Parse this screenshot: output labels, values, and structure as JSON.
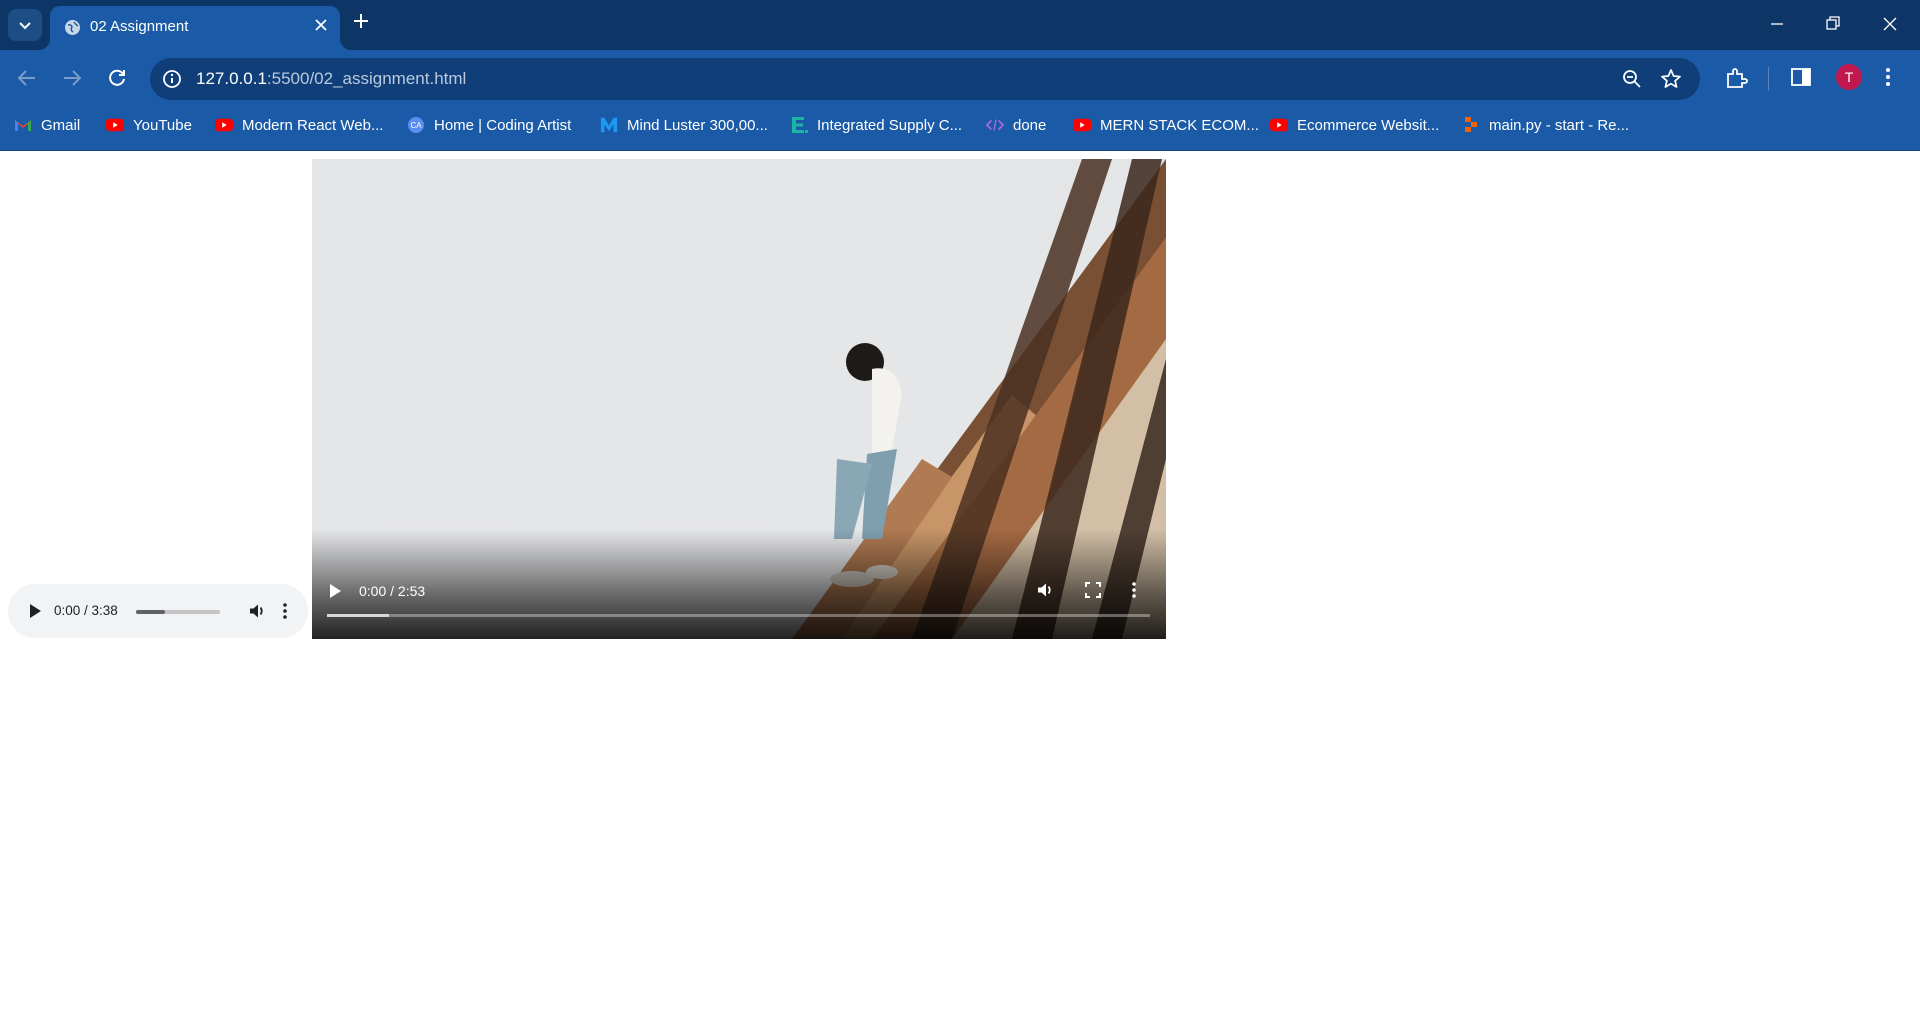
{
  "browser": {
    "tab": {
      "title": "02 Assignment"
    },
    "omnibox": {
      "url_host": "127.0.0.1",
      "url_path": ":5500/02_assignment.html"
    },
    "profile_initial": "T"
  },
  "bookmarks": [
    {
      "label": "Gmail",
      "icon": "gmail-icon"
    },
    {
      "label": "YouTube",
      "icon": "youtube-icon"
    },
    {
      "label": "Modern React Web...",
      "icon": "youtube-icon"
    },
    {
      "label": "Home | Coding Artist",
      "icon": "coding-artist-icon"
    },
    {
      "label": "Mind Luster 300,00...",
      "icon": "mind-luster-icon"
    },
    {
      "label": "Integrated Supply C...",
      "icon": "e-icon"
    },
    {
      "label": "done",
      "icon": "code-icon"
    },
    {
      "label": "MERN STACK ECOM...",
      "icon": "youtube-icon"
    },
    {
      "label": "Ecommerce Websit...",
      "icon": "youtube-icon"
    },
    {
      "label": "main.py - start - Re...",
      "icon": "replit-icon"
    }
  ],
  "audio": {
    "time": "0:00 / 3:38",
    "volume_level": 0.35
  },
  "video": {
    "time": "0:00 / 2:53",
    "buffered_fraction": 0.075
  },
  "colors": {
    "tabstrip": "#0d3565",
    "toolbar": "#1a5aa6",
    "omnibox": "#0f3e78",
    "avatar": "#c0184f",
    "youtube_red": "#ff0000"
  }
}
